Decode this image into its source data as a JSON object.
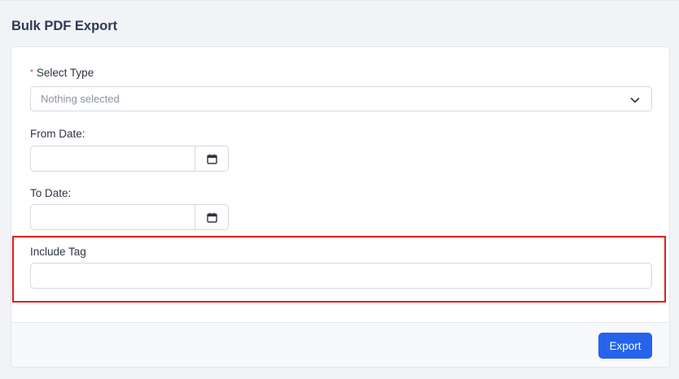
{
  "page": {
    "title": "Bulk PDF Export"
  },
  "form": {
    "select_type": {
      "required_mark": "*",
      "label": "Select Type",
      "value": "Nothing selected",
      "icon": "chevron-down-icon"
    },
    "from_date": {
      "label": "From Date:",
      "value": "",
      "icon": "calendar-icon"
    },
    "to_date": {
      "label": "To Date:",
      "value": "",
      "icon": "calendar-icon"
    },
    "include_tag": {
      "label": "Include Tag",
      "value": ""
    }
  },
  "footer": {
    "export_label": "Export"
  },
  "colors": {
    "accent": "#2563eb",
    "highlight_border": "#e01e1e",
    "required": "#e03131"
  }
}
